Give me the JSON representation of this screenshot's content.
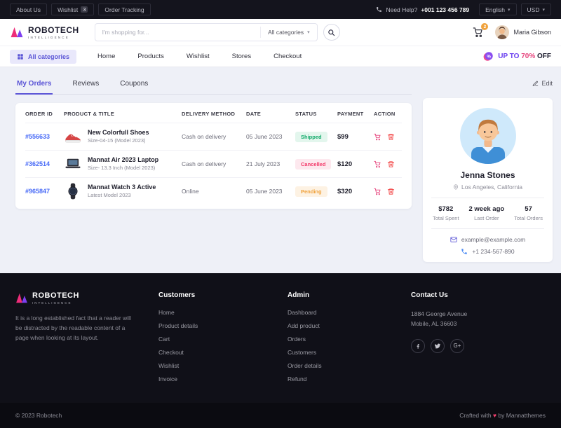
{
  "icons": {
    "chevron_down": "▾",
    "percent": "%",
    "gplus": "G+"
  },
  "topbar": {
    "links": [
      {
        "label": "About Us"
      },
      {
        "label": "Wishlist",
        "badge": "3"
      },
      {
        "label": "Order Tracking"
      }
    ],
    "help_label": "Need Help?",
    "phone": "+001 123 456 789",
    "language": "English",
    "currency": "USD"
  },
  "header": {
    "brand": "ROBOTECH",
    "brand_sub": "INTELLIGENCE",
    "search": {
      "placeholder": "I'm shopping for...",
      "categories": "All categories"
    },
    "cart_count": "2",
    "user": "Maria Gibson"
  },
  "nav": {
    "all_categories": "All categories",
    "items": [
      {
        "label": "Home"
      },
      {
        "label": "Products"
      },
      {
        "label": "Wishlist"
      },
      {
        "label": "Stores"
      },
      {
        "label": "Checkout"
      }
    ],
    "promo": {
      "prefix": "UP TO",
      "highlight": "70%",
      "suffix": "OFF"
    }
  },
  "tabs": [
    {
      "label": "My Orders"
    },
    {
      "label": "Reviews"
    },
    {
      "label": "Coupons"
    }
  ],
  "edit_label": "Edit",
  "orders": {
    "headers": [
      "ORDER ID",
      "PRODUCT & TITLE",
      "DELIVERY METHOD",
      "DATE",
      "STATUS",
      "PAYMENT",
      "ACTION"
    ],
    "rows": [
      {
        "id": "#556633",
        "title": "New Colorfull Shoes",
        "subtitle": "Size-04-15 (Model 2023)",
        "delivery": "Cash on delivery",
        "date": "05 June 2023",
        "status": "Shipped",
        "status_class": "badge shipped",
        "payment": "$99"
      },
      {
        "id": "#362514",
        "title": "Mannat Air 2023 Laptop",
        "subtitle": "Size- 13.3 Inch (Model 2023)",
        "delivery": "Cash on delivery",
        "date": "21 July 2023",
        "status": "Cancelled",
        "status_class": "badge cancelled",
        "payment": "$120"
      },
      {
        "id": "#965847",
        "title": "Mannat Watch 3 Active",
        "subtitle": "Latest Model 2023",
        "delivery": "Online",
        "date": "05 June 2023",
        "status": "Pending",
        "status_class": "badge pending",
        "payment": "$320"
      }
    ]
  },
  "profile": {
    "name": "Jenna Stones",
    "location": "Los Angeles, California",
    "stats": [
      {
        "value": "$782",
        "label": "Total Spent"
      },
      {
        "value": "2 week ago",
        "label": "Last Order"
      },
      {
        "value": "57",
        "label": "Total Orders"
      }
    ],
    "email": "example@example.com",
    "phone": "+1 234-567-890"
  },
  "footer": {
    "brand": "ROBOTECH",
    "brand_sub": "INTELLIGENCE",
    "about": "It is a long established fact that a reader will be distracted by the readable content of a page when looking at its layout.",
    "columns": [
      {
        "title": "Customers",
        "links": [
          "Home",
          "Product details",
          "Cart",
          "Checkout",
          "Wishlist",
          "Invoice"
        ]
      },
      {
        "title": "Admin",
        "links": [
          "Dashboard",
          "Add product",
          "Orders",
          "Customers",
          "Order details",
          "Refund"
        ]
      }
    ],
    "contact": {
      "title": "Contact Us",
      "address_line1": "1884 George Avenue",
      "address_line2": "Mobile, AL 36603"
    },
    "copyright": "© 2023 Robotech",
    "crafted_prefix": "Crafted with",
    "crafted_heart": "♥",
    "crafted_suffix": "by Mannatthemes"
  },
  "colors": {
    "accent": "#5b55d6",
    "magenta": "#e6447d",
    "shipped": "#0fa968",
    "cancelled": "#f33a6a",
    "pending": "#f0a23c"
  }
}
